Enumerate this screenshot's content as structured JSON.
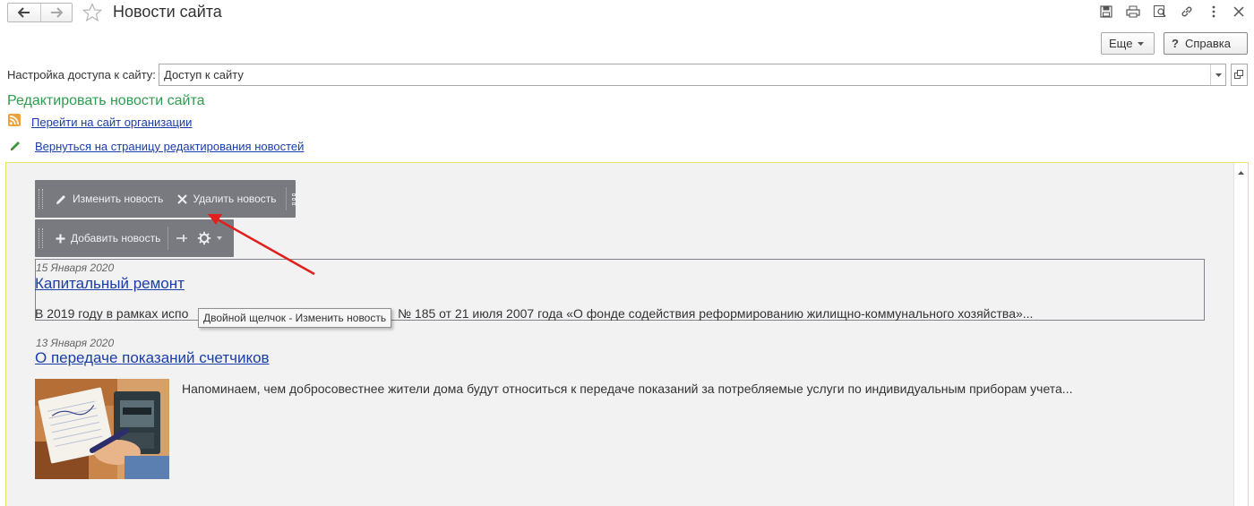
{
  "window": {
    "title": "Новости сайта",
    "more_label": "Еще",
    "help_label": "Справка",
    "help_icon": "?"
  },
  "access": {
    "label": "Настройка доступа к сайту:",
    "value": "Доступ к сайту"
  },
  "section": {
    "title": "Редактировать новости сайта",
    "links": [
      "Перейти на сайт организации",
      "Вернуться на страницу редактирования новостей"
    ]
  },
  "toolbar": {
    "edit_label": "Изменить новость",
    "delete_label": "Удалить новость",
    "add_label": "Добавить новость"
  },
  "tooltip": "Двойной щелчок - Изменить новость",
  "news": [
    {
      "date": "15 Января 2020",
      "title": "Капитальный ремонт",
      "text_start": "В 2019 году в рамках испо",
      "text_end": "№ 185 от 21 июля 2007 года «О фонде содействия реформированию жилищно-коммунального хозяйства»..."
    },
    {
      "date": "13 Января 2020",
      "title": "О передаче показаний счетчиков",
      "text": "Напоминаем, чем добросовестнее жители дома будут относиться к передаче показаний за потребляемые услуги по индивидуальным приборам учета..."
    }
  ],
  "colors": {
    "section_title": "#2e9c4e",
    "link": "#1a3ea8",
    "toolbar_bg": "#787a80",
    "frame_border": "#e8e26a",
    "arrow": "#e0201c"
  }
}
